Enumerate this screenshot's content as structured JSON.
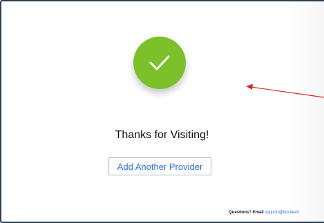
{
  "confirmation": {
    "heading": "Thanks for Visiting!",
    "icon": "check-circle-icon",
    "icon_color": "#7dc12a"
  },
  "actions": {
    "add_provider_label": "Add Another Provider"
  },
  "footer": {
    "question_text": "Questions? Email",
    "email": "support@fup.healt"
  },
  "annotation": {
    "arrow_color": "#e02020"
  },
  "colors": {
    "link": "#2a6fdb",
    "border": "#2c3e50"
  }
}
